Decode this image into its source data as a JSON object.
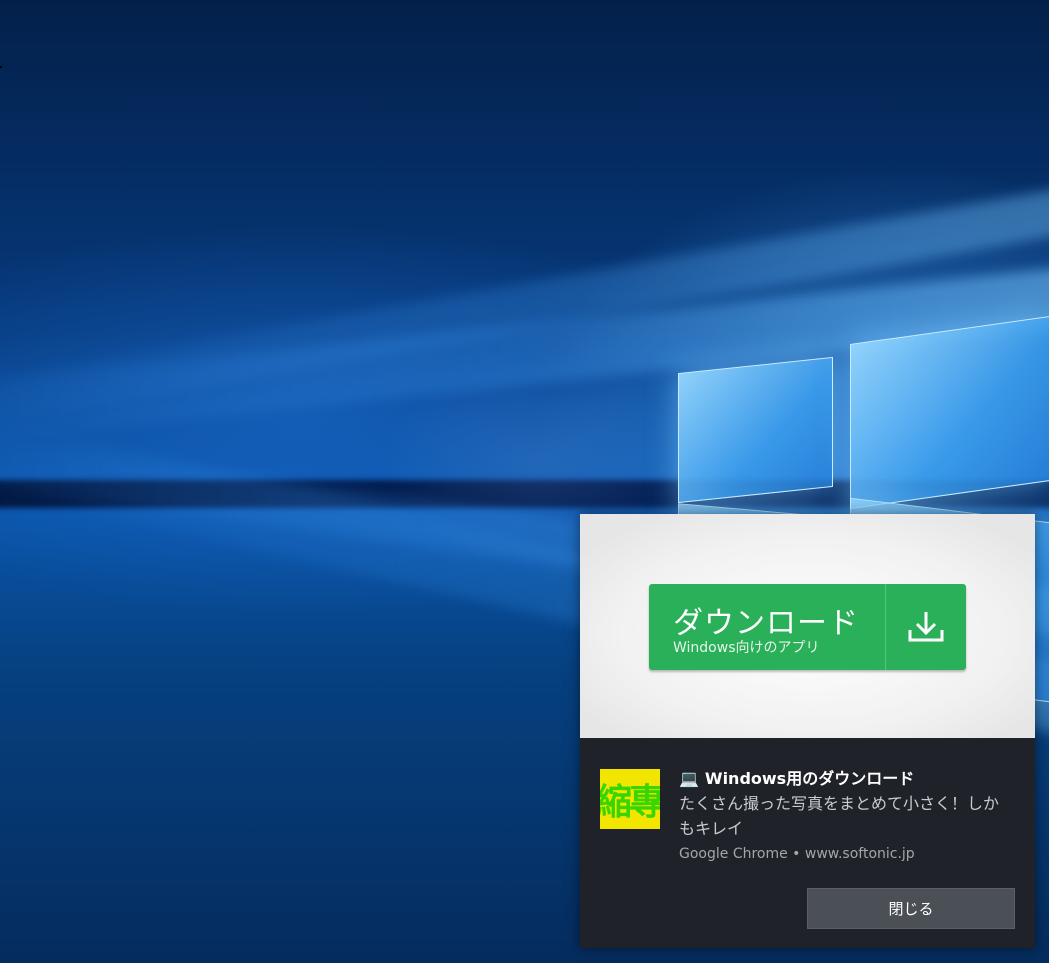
{
  "desktop": {
    "wallpaper": "windows-10-default-wallpaper"
  },
  "toast": {
    "hero": {
      "download_button": {
        "title": "ダウンロード",
        "subtitle": "Windows向けのアプリ",
        "icon": "download-icon",
        "color": "#2ab058"
      }
    },
    "app_logo": {
      "text": "縮專.",
      "background": "#f2e500",
      "text_color": "#38d600"
    },
    "title_icon": "💻",
    "title": "Windows用のダウンロード",
    "message": "たくさん撮った写真をまとめて小さく！しかもキレイ",
    "source": "Google Chrome • www.softonic.jp",
    "close_label": "閉じる"
  }
}
